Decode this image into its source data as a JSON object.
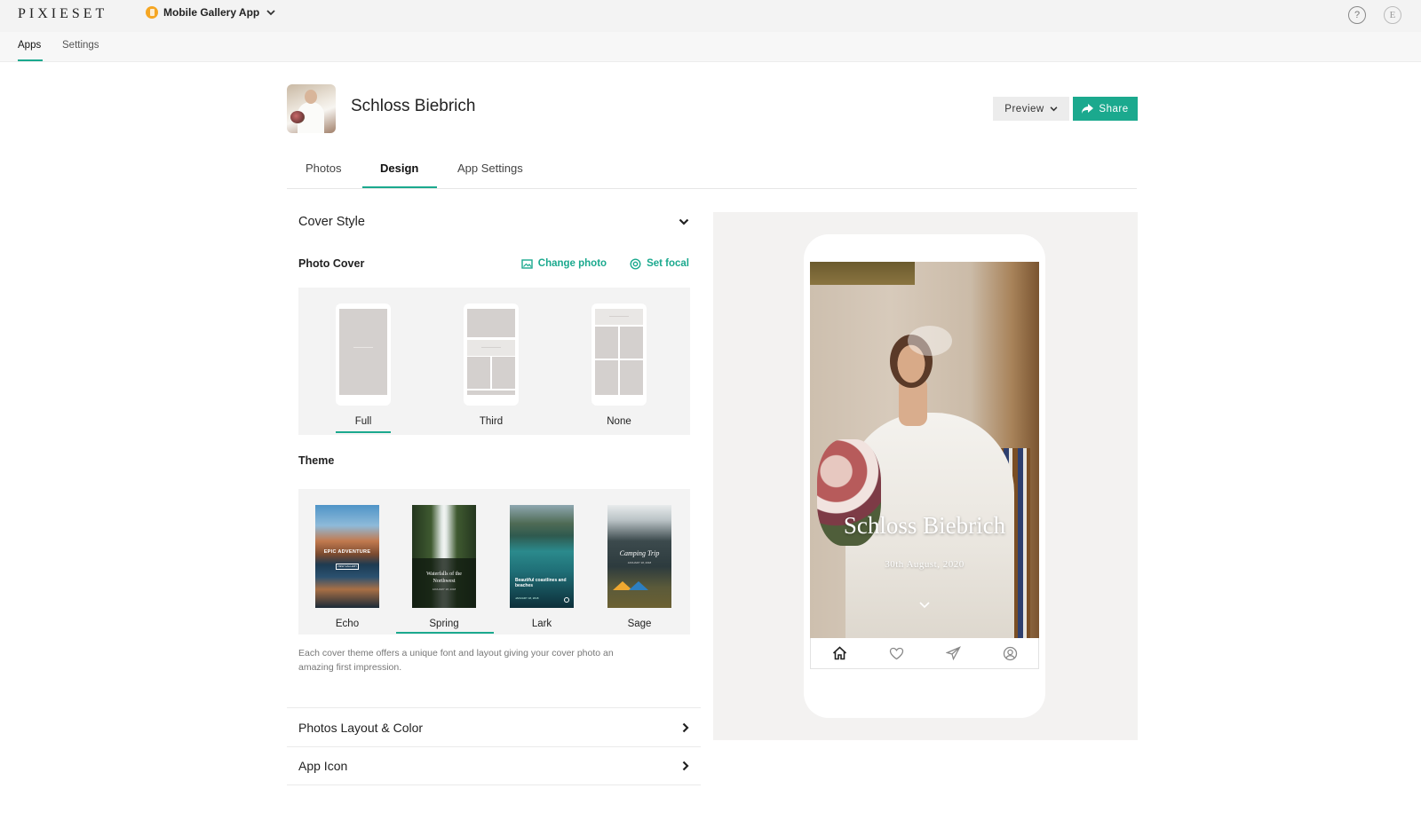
{
  "brand": "PIXIESET",
  "app_switcher": {
    "label": "Mobile Gallery App"
  },
  "top_nav": {
    "items": [
      {
        "label": "Apps"
      },
      {
        "label": "Settings"
      }
    ],
    "active": "Apps"
  },
  "gallery": {
    "title": "Schloss Biebrich"
  },
  "buttons": {
    "preview": "Preview",
    "share": "Share"
  },
  "tabs": [
    {
      "label": "Photos"
    },
    {
      "label": "Design"
    },
    {
      "label": "App Settings"
    }
  ],
  "active_tab": "Design",
  "cover_style": {
    "title": "Cover Style",
    "photo_cover_label": "Photo Cover",
    "change_photo": "Change photo",
    "set_focal": "Set focal",
    "options": [
      {
        "label": "Full"
      },
      {
        "label": "Third"
      },
      {
        "label": "None"
      }
    ],
    "selected": "Full"
  },
  "theme": {
    "title": "Theme",
    "options": [
      {
        "label": "Echo",
        "card_text": "EPIC ADVENTURE",
        "card_button": "VIEW GALLERY"
      },
      {
        "label": "Spring",
        "card_text": "Waterfalls of the Northwest",
        "card_date": "JANUARY 18, 2018"
      },
      {
        "label": "Lark",
        "card_text": "Beautiful coastlines and beaches",
        "card_date": "JANUARY 18, 2018"
      },
      {
        "label": "Sage",
        "card_text": "Camping Trip",
        "card_date": "JANUARY 18, 2018"
      }
    ],
    "selected": "Spring",
    "hint": "Each cover theme offers a unique font and layout giving your cover photo an amazing first impression."
  },
  "sections": [
    {
      "label": "Photos Layout & Color"
    },
    {
      "label": "App Icon"
    }
  ],
  "preview_phone": {
    "cover_title": "Schloss Biebrich",
    "cover_date": "30th August, 2020"
  },
  "colors": {
    "accent": "#1ba98e",
    "panel_bg": "#f3f3f3",
    "preview_bg": "#f3f2f1"
  }
}
